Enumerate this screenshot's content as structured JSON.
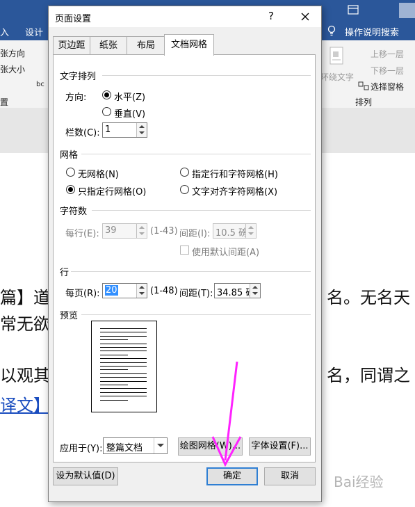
{
  "background": {
    "ribbon_tabs": [
      "入",
      "设计"
    ],
    "ribbon_left_items": [
      "张方向",
      "张大小",
      "bc",
      "置"
    ],
    "ribbon_right_items": {
      "move_up": "上移一层",
      "move_down": "下移一层",
      "wrap_text": "环绕文字",
      "selection_pane": "选择窗格",
      "arrange_group": "排列",
      "tell_me": "操作说明搜索"
    },
    "doc_lines": [
      {
        "left": "篇】道",
        "right": "名。无名天"
      },
      {
        "left": "常无欲",
        "right": ""
      },
      {
        "left": "以观其",
        "right": "名，同谓之"
      },
      {
        "left": "译文】",
        "right": ""
      }
    ],
    "watermark": "Bai经验"
  },
  "dialog": {
    "title": "页面设置",
    "help": "?",
    "tabs": [
      "页边距",
      "纸张",
      "布局",
      "文档网格"
    ],
    "active_tab": 3,
    "text_direction": {
      "section": "文字排列",
      "direction_label": "方向:",
      "horizontal": "水平(Z)",
      "vertical": "垂直(V)",
      "columns_label": "栏数(C):",
      "columns_value": "1"
    },
    "grid": {
      "section": "网格",
      "options": [
        "无网格(N)",
        "指定行和字符网格(H)",
        "只指定行网格(O)",
        "文字对齐字符网格(X)"
      ],
      "selected": "只指定行网格(O)"
    },
    "chars": {
      "section": "字符数",
      "per_line_label": "每行(E):",
      "per_line_value": "39",
      "per_line_range": "(1-43)",
      "pitch_label": "间距(I):",
      "pitch_value": "10.5 磅",
      "default_pitch": "使用默认间距(A)"
    },
    "lines": {
      "section": "行",
      "per_page_label": "每页(R):",
      "per_page_value": "20",
      "per_page_range": "(1-48)",
      "pitch_label": "间距(T):",
      "pitch_value": "34.85 磅"
    },
    "preview_label": "预览",
    "apply_to_label": "应用于(Y):",
    "apply_to_value": "整篇文档",
    "draw_grid_button": "绘图网格(W)...",
    "font_settings_button": "字体设置(F)...",
    "set_default_button": "设为默认值(D)",
    "ok_button": "确定",
    "cancel_button": "取消"
  },
  "colors": {
    "ribbon_blue": "#2b579a",
    "annotation_arrow": "#ff22ff",
    "primary_border": "#2f7fd3"
  }
}
